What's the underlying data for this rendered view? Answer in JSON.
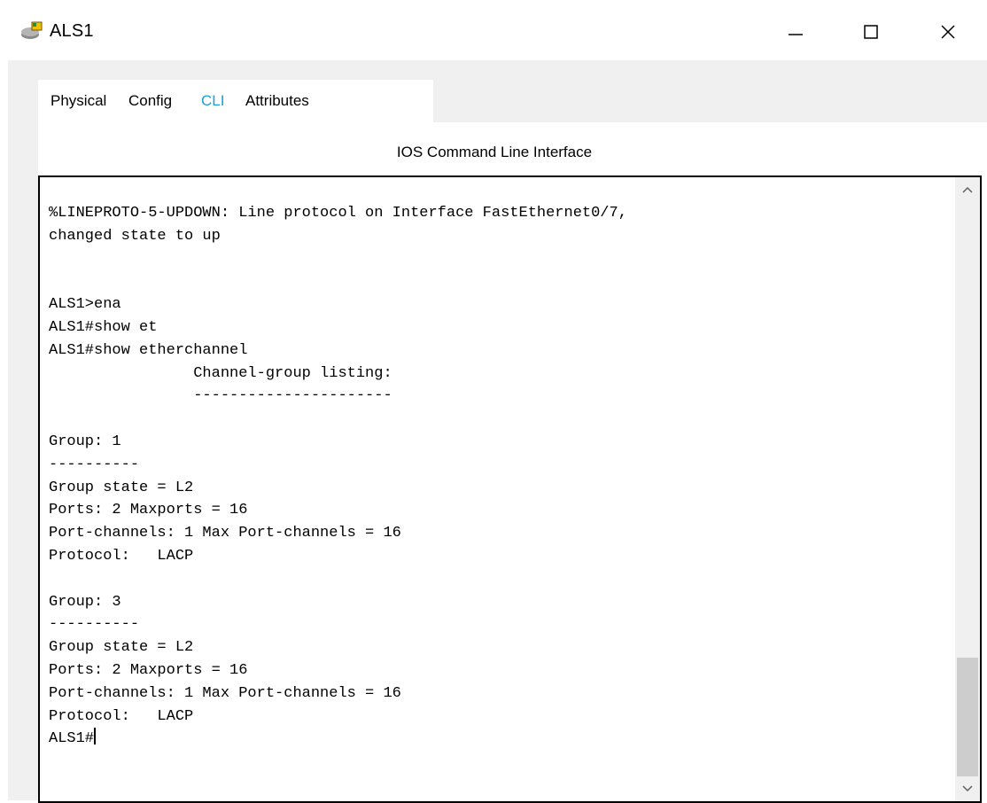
{
  "window": {
    "title": "ALS1",
    "icon": "switch-app-icon",
    "controls": [
      "minimize-icon",
      "maximize-icon",
      "close-icon"
    ]
  },
  "tabs": [
    {
      "label": "Physical",
      "active": false
    },
    {
      "label": "Config",
      "active": false
    },
    {
      "label": "CLI",
      "active": true
    },
    {
      "label": "Attributes",
      "active": false
    }
  ],
  "accent_color": "#1a9fd9",
  "panel": {
    "title": "IOS Command Line Interface"
  },
  "terminal": {
    "lines": [
      "%LINEPROTO-5-UPDOWN: Line protocol on Interface FastEthernet0/7,",
      "changed state to up",
      "",
      "",
      "ALS1>ena",
      "ALS1#show et",
      "ALS1#show etherchannel",
      "                Channel-group listing:",
      "                ----------------------",
      "",
      "Group: 1",
      "----------",
      "Group state = L2",
      "Ports: 2 Maxports = 16",
      "Port-channels: 1 Max Port-channels = 16",
      "Protocol:   LACP",
      "",
      "Group: 3",
      "----------",
      "Group state = L2",
      "Ports: 2 Maxports = 16",
      "Port-channels: 1 Max Port-channels = 16",
      "Protocol:   LACP"
    ],
    "prompt": "ALS1#"
  }
}
